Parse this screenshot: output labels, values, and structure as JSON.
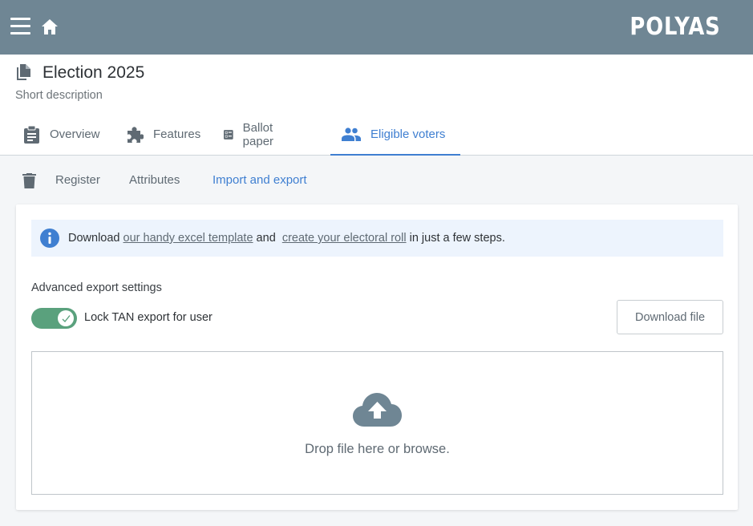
{
  "topbar": {
    "brand": "POLYAS",
    "menu_icon": "hamburger-menu-icon",
    "home_icon": "home-icon",
    "background": "#6f8694"
  },
  "election": {
    "title": "Election 2025",
    "description": "Short description"
  },
  "tabs": [
    {
      "label": "Overview",
      "icon": "clipboard-icon"
    },
    {
      "label": "Features",
      "icon": "puzzle-icon"
    },
    {
      "label": "Ballot paper",
      "icon": "ballot-icon"
    },
    {
      "label": "Eligible voters",
      "icon": "people-icon",
      "active": true
    }
  ],
  "subnav": {
    "trash_icon": "trash-icon",
    "items": [
      {
        "label": "Register"
      },
      {
        "label": "Attributes"
      },
      {
        "label": "Import and export",
        "active": true
      }
    ]
  },
  "info": {
    "prefix": "Download ",
    "link1": "our handy excel template",
    "middle": " and ",
    "link2": "create your electoral roll",
    "suffix": " in just a few steps."
  },
  "export": {
    "section_label": "Advanced export settings",
    "toggle_label": "Lock TAN export for user",
    "toggle_on": true,
    "download_button": "Download file"
  },
  "dropzone": {
    "text": "Drop file here or browse.",
    "icon": "cloud-upload-icon"
  },
  "colors": {
    "accent": "#3f7fd1",
    "toggle": "#5aa17d",
    "info_bg": "#edf4fd"
  }
}
